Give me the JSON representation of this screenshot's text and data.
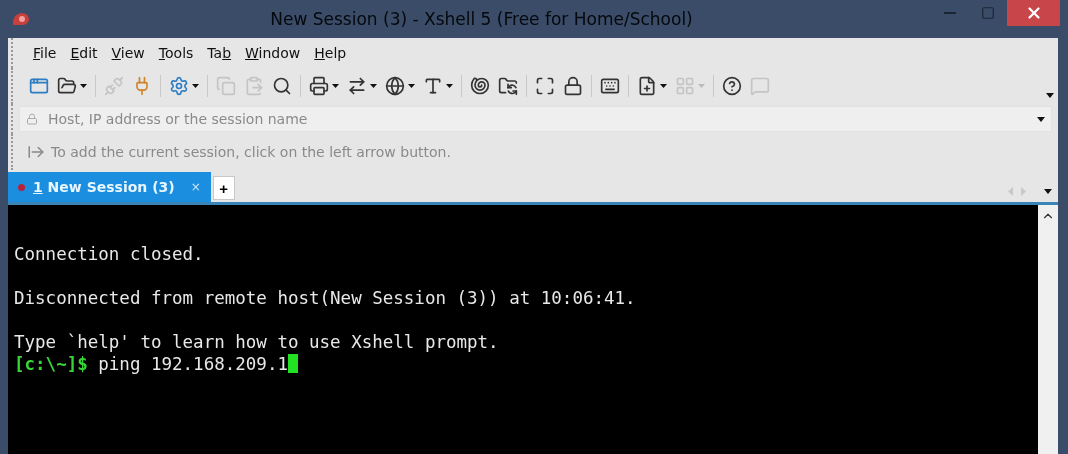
{
  "window": {
    "title": "New Session (3) - Xshell 5 (Free for Home/School)",
    "active": false
  },
  "menu": [
    {
      "key": "F",
      "after": "ile"
    },
    {
      "key": "E",
      "after": "dit"
    },
    {
      "key": "V",
      "after": "iew"
    },
    {
      "key": "T",
      "after": "ools"
    },
    {
      "before": "Ta",
      "key": "b"
    },
    {
      "key": "W",
      "after": "indow"
    },
    {
      "key": "H",
      "after": "elp"
    }
  ],
  "toolbar": [
    {
      "disabled": false,
      "dropdown": false
    },
    {
      "disabled": false,
      "dropdown": true
    },
    {
      "disabled": true,
      "dropdown": false
    },
    {
      "disabled": false,
      "dropdown": false
    },
    {
      "disabled": false,
      "dropdown": true
    },
    {
      "disabled": true,
      "dropdown": false
    },
    {
      "disabled": true,
      "dropdown": false
    },
    {
      "disabled": false,
      "dropdown": false
    },
    {
      "disabled": false,
      "dropdown": true
    },
    {
      "disabled": false,
      "dropdown": true
    },
    {
      "disabled": false,
      "dropdown": true
    },
    {
      "disabled": false,
      "dropdown": true
    },
    {
      "disabled": false,
      "dropdown": false
    },
    {
      "disabled": false,
      "dropdown": false
    },
    {
      "disabled": false,
      "dropdown": false
    },
    {
      "disabled": false,
      "dropdown": false
    },
    {
      "disabled": false,
      "dropdown": false
    },
    {
      "disabled": false,
      "dropdown": true
    },
    {
      "disabled": true,
      "dropdown": true
    },
    {
      "disabled": false,
      "dropdown": false
    },
    {
      "disabled": true,
      "dropdown": false
    }
  ],
  "address_bar": {
    "placeholder": "Host, IP address or the session name"
  },
  "info_bar": {
    "text": "To add the current session, click on the left arrow button."
  },
  "tabs": [
    {
      "key": "1",
      "after": " New Session (3)",
      "selected": true,
      "connected": false,
      "close": "×"
    }
  ],
  "new_tab": "+",
  "terminal": {
    "lines": [
      "Connection closed.",
      "Disconnected from remote host(New Session (3)) at 10:06:41.",
      "Type `help' to learn how to use Xshell prompt."
    ],
    "prompt": "[c:\\~]$",
    "command": " ping 192.168.209.1"
  }
}
